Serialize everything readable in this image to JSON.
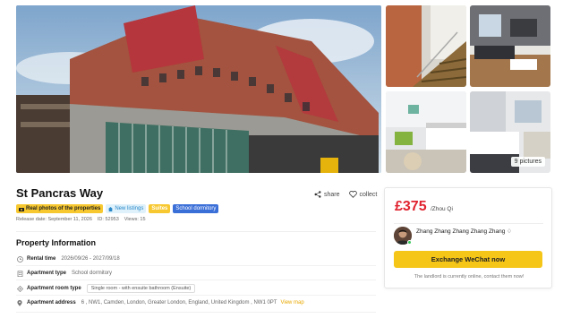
{
  "gallery": {
    "pictures_count_label": "9 pictures"
  },
  "property": {
    "title": "St Pancras Way",
    "actions": {
      "share": "share",
      "collect": "collect"
    },
    "tags": [
      {
        "label": "Real photos of the properties",
        "icon": "camera-icon"
      },
      {
        "label": "New listings",
        "icon": "house-icon"
      },
      {
        "label": "Suites"
      },
      {
        "label": "School dormitory"
      }
    ],
    "meta": {
      "release_date": "Release date: September 11, 2026",
      "id": "ID: 52953",
      "views": "Views: 15"
    }
  },
  "info": {
    "section_title": "Property Information",
    "rows": [
      {
        "label": "Rental time",
        "value": "2026/09/26 - 2027/09/18",
        "icon": "clock-icon"
      },
      {
        "label": "Apartment type",
        "value": "School dormitory",
        "icon": "building-icon"
      },
      {
        "label": "Apartment room type",
        "value": "Single room - with ensuite bathroom (Ensuite)",
        "icon": "room-icon"
      },
      {
        "label": "Apartment address",
        "value": "6 , NW1, Camden, London, Greater London, England, United Kingdom , NW1 0PT",
        "icon": "location-pin-icon",
        "link": "View map"
      }
    ]
  },
  "card": {
    "price": "£375",
    "price_unit": "/Zhou Qi",
    "agent_name": "Zhang Zhang Zhang Zhang Zhang ♢",
    "button_label": "Exchange WeChat now",
    "online_note": "The landlord is currently online, contact them now!",
    "accent_color": "#f5c518",
    "price_color": "#e0232f"
  }
}
